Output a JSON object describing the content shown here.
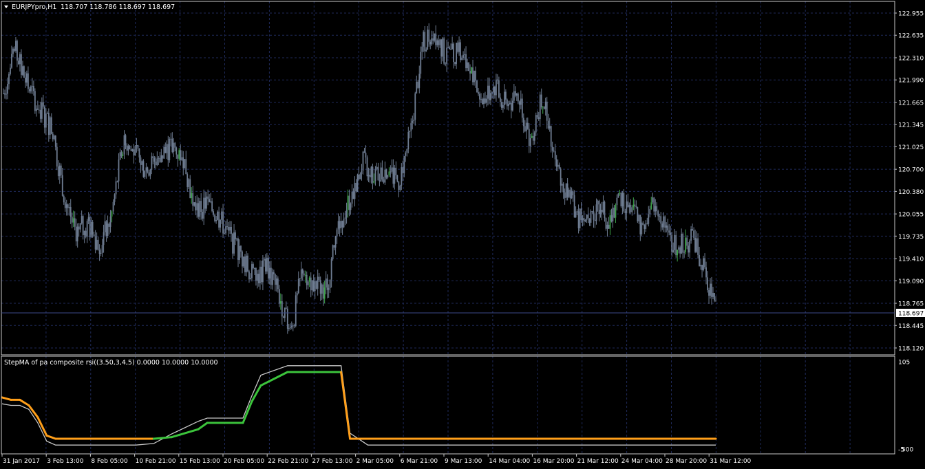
{
  "main_header": {
    "symbol_label": "EURJPYpro,H1",
    "ohlc_label": "118.707 118.786 118.697 118.697"
  },
  "indicator_header": "StepMA of pa composite rsi((3.50,3,4,5) 0.0000 10.0000 10.0000",
  "price_axis": {
    "labels": [
      "122.955",
      "122.635",
      "122.310",
      "121.990",
      "121.665",
      "121.345",
      "121.025",
      "120.700",
      "120.380",
      "120.055",
      "119.735",
      "119.410",
      "119.090",
      "118.765",
      "118.445",
      "118.120"
    ],
    "range": [
      118.12,
      122.955
    ],
    "current_price": "118.697"
  },
  "indicator_axis": {
    "labels": [
      "105",
      "-5"
    ],
    "label_extra": "500",
    "range": [
      -5,
      105
    ]
  },
  "time_axis": {
    "labels": [
      "31 Jan 2017",
      "3 Feb 13:00",
      "8 Feb 05:00",
      "10 Feb 21:00",
      "15 Feb 13:00",
      "20 Feb 05:00",
      "22 Feb 21:00",
      "27 Feb 13:00",
      "2 Mar 05:00",
      "6 Mar 21:00",
      "9 Mar 13:00",
      "14 Mar 04:00",
      "16 Mar 20:00",
      "21 Mar 12:00",
      "24 Mar 04:00",
      "28 Mar 20:00",
      "31 Mar 12:00"
    ]
  },
  "colors": {
    "background": "#000000",
    "grid": "#1f2a5a",
    "candles": "#6f7d92",
    "candles_up_highlight": "#3ea34a",
    "step_up": "#3cc43c",
    "step_down": "#ff9f1a",
    "composite_line": "#c8c8c8",
    "axis_border": "#c8c8c8",
    "price_tag_bg": "#ffffff",
    "price_tag_text": "#000000"
  },
  "chart_data": [
    {
      "type": "line",
      "title": "EURJPYpro,H1",
      "ylim": [
        118.12,
        122.955
      ],
      "x": [
        0,
        2,
        4,
        6,
        8,
        10,
        12,
        14,
        16,
        18,
        20,
        22,
        24,
        26,
        28,
        30,
        32,
        34,
        36,
        38,
        40,
        42,
        44,
        46,
        48,
        50,
        52,
        54,
        56,
        58,
        60,
        62,
        64,
        66,
        68,
        70,
        72,
        74,
        76,
        78,
        80,
        82,
        84,
        86,
        88,
        90,
        92,
        94,
        96,
        98,
        100
      ],
      "values": [
        121.8,
        122.4,
        121.9,
        121.6,
        121.3,
        120.4,
        119.8,
        119.9,
        119.6,
        120.0,
        121.1,
        120.9,
        120.7,
        120.9,
        121.0,
        120.9,
        120.1,
        120.2,
        120.0,
        119.7,
        119.4,
        119.1,
        119.3,
        118.9,
        118.3,
        119.3,
        119.0,
        119.0,
        119.9,
        120.3,
        120.8,
        120.6,
        120.7,
        120.5,
        121.2,
        122.5,
        122.7,
        122.3,
        122.4,
        122.1,
        121.7,
        121.9,
        121.6,
        121.8,
        121.1,
        121.8,
        120.8,
        120.4,
        120.0,
        119.9,
        120.2
      ],
      "x_extra": [
        101,
        103,
        105,
        107,
        109,
        111,
        113,
        115,
        117,
        119
      ],
      "values_extra": [
        119.8,
        120.3,
        120.1,
        119.8,
        120.3,
        119.7,
        119.6,
        119.7,
        119.3,
        118.7
      ]
    },
    {
      "type": "line",
      "title": "StepMA of pa composite rsi((3.50,3,4,5) 0.0000 10.0000 10.0000",
      "ylim": [
        -5,
        105
      ],
      "series": [
        {
          "x": [
            0,
            1,
            2,
            3,
            4,
            5,
            6,
            10,
            14,
            15,
            17,
            19,
            22,
            23,
            27,
            28,
            29,
            32,
            38,
            39,
            41,
            44,
            49,
            50,
            52,
            54,
            58,
            59,
            63,
            64,
            66,
            68,
            69,
            80
          ],
          "values": [
            60,
            57,
            57,
            50,
            35,
            12,
            8,
            8,
            8,
            8,
            8,
            10,
            20,
            28,
            28,
            55,
            75,
            92,
            92,
            8,
            8,
            8,
            8,
            8,
            8,
            8,
            8,
            8,
            8,
            8,
            8,
            8,
            8,
            8
          ]
        },
        {
          "x": [
            0,
            1,
            2,
            3,
            4,
            5,
            6,
            10,
            14,
            15,
            17,
            19,
            22,
            23,
            27,
            28,
            29,
            32,
            38,
            39,
            41,
            44,
            49,
            50,
            52,
            54,
            58,
            59,
            63,
            64,
            66,
            68,
            69,
            80
          ],
          "values": [
            52,
            50,
            50,
            45,
            28,
            5,
            0,
            0,
            0,
            0,
            2,
            14,
            30,
            34,
            34,
            62,
            88,
            100,
            100,
            15,
            0,
            0,
            0,
            0,
            0,
            0,
            0,
            0,
            0,
            0,
            0,
            0,
            0,
            0
          ]
        }
      ]
    }
  ]
}
